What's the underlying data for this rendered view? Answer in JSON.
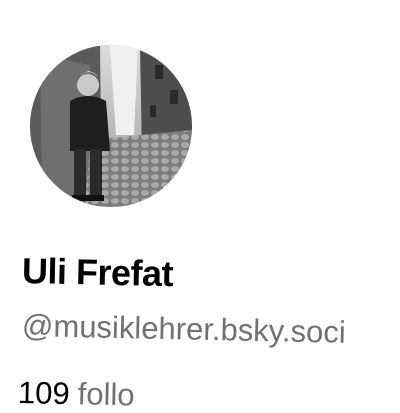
{
  "profile": {
    "display_name": "Uli Frefat",
    "handle": "@musiklehrer.bsky.soci",
    "avatar": "profile-photo"
  },
  "stats": {
    "followers_count": "109",
    "followers_label": "follo"
  }
}
